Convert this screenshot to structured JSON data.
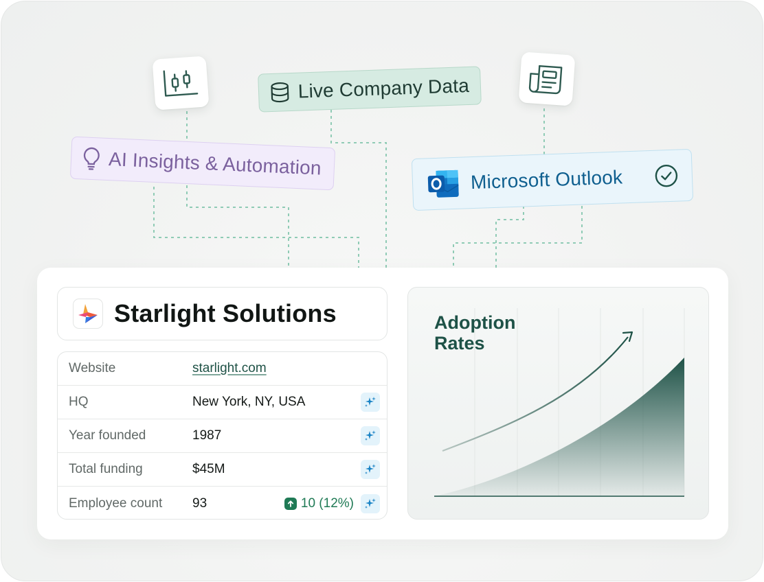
{
  "chips": {
    "live_data": {
      "label": "Live Company Data",
      "icon": "database-icon"
    },
    "ai_insights": {
      "label": "AI Insights & Automation",
      "icon": "lightbulb-icon"
    },
    "outlook": {
      "label": "Microsoft Outlook",
      "icon": "outlook-logo",
      "status_icon": "check-circle-icon"
    }
  },
  "icon_cards": [
    "candlestick-chart-icon",
    "newspaper-icon"
  ],
  "company": {
    "name": "Starlight Solutions",
    "logo": "starlight-logo"
  },
  "details": [
    {
      "key": "Website",
      "value": "starlight.com",
      "is_link": true
    },
    {
      "key": "HQ",
      "value": "New York, NY, USA",
      "enrich_icon": "sparkle-icon"
    },
    {
      "key": "Year founded",
      "value": "1987",
      "enrich_icon": "sparkle-icon"
    },
    {
      "key": "Total funding",
      "value": "$45M",
      "enrich_icon": "sparkle-icon"
    },
    {
      "key": "Employee count",
      "value": "93",
      "delta": "10 (12%)",
      "delta_direction": "up",
      "enrich_icon": "sparkle-icon"
    }
  ],
  "chart_data": {
    "type": "area",
    "title": "Adoption Rates",
    "xlabel": "",
    "ylabel": "",
    "grid": "vertical",
    "trend_arrow": true
  },
  "colors": {
    "accent_green": "#1e5247",
    "positive": "#1f7a55",
    "outlook_blue": "#0f5f8f",
    "ai_purple": "#7b619e"
  }
}
